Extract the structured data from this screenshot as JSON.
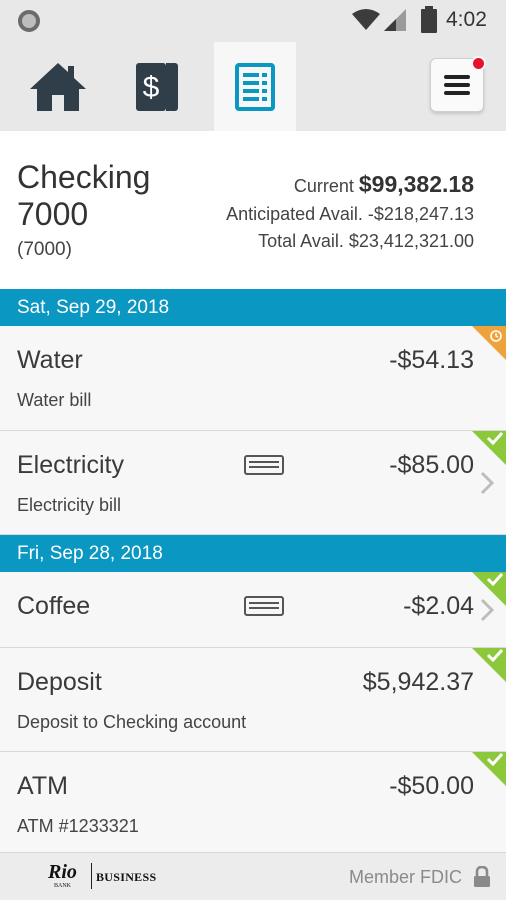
{
  "status_bar": {
    "time": "4:02",
    "icons": [
      "circle-indicator-icon",
      "wifi-icon",
      "signal-icon",
      "battery-icon"
    ]
  },
  "tabs": [
    {
      "name": "home",
      "icon": "home-icon",
      "active": false
    },
    {
      "name": "accounts",
      "icon": "dollar-cards-icon",
      "active": false
    },
    {
      "name": "transactions",
      "icon": "document-list-icon",
      "active": true
    }
  ],
  "menu": {
    "icon": "hamburger-menu-icon",
    "has_notification": true
  },
  "account": {
    "name": "Checking 7000",
    "number": "(7000)",
    "current_label": "Current",
    "current_value": "$99,382.18",
    "anticipated_label": "Anticipated Avail.",
    "anticipated_value": "-$218,247.13",
    "total_label": "Total Avail.",
    "total_value": "$23,412,321.00"
  },
  "groups": [
    {
      "date": "Sat, Sep 29, 2018",
      "transactions": [
        {
          "name": "Water",
          "amount": "-$54.13",
          "description": "Water bill",
          "status": "pending",
          "has_card": false,
          "has_chevron": false
        },
        {
          "name": "Electricity",
          "amount": "-$85.00",
          "description": "Electricity bill",
          "status": "cleared",
          "has_card": true,
          "has_chevron": true
        }
      ]
    },
    {
      "date": "Fri, Sep 28, 2018",
      "transactions": [
        {
          "name": "Coffee",
          "amount": "-$2.04",
          "description": "",
          "status": "cleared",
          "has_card": true,
          "has_chevron": true
        },
        {
          "name": "Deposit",
          "amount": "$5,942.37",
          "description": "Deposit to Checking account",
          "status": "cleared",
          "has_card": false,
          "has_chevron": false
        },
        {
          "name": "ATM",
          "amount": "-$50.00",
          "description": "ATM #1233321",
          "status": "cleared",
          "has_card": false,
          "has_chevron": false
        }
      ]
    }
  ],
  "footer": {
    "logo_text": "Rio",
    "logo_sub": "BANK",
    "logo_business": "BUSINESS",
    "fdic_text": "Member FDIC",
    "lock_icon": "lock-icon"
  },
  "colors": {
    "accent": "#0a97c2",
    "cleared": "#8cc83c",
    "pending": "#f0a23a",
    "notification": "#e8112d",
    "icon_dark": "#2f3e48"
  }
}
